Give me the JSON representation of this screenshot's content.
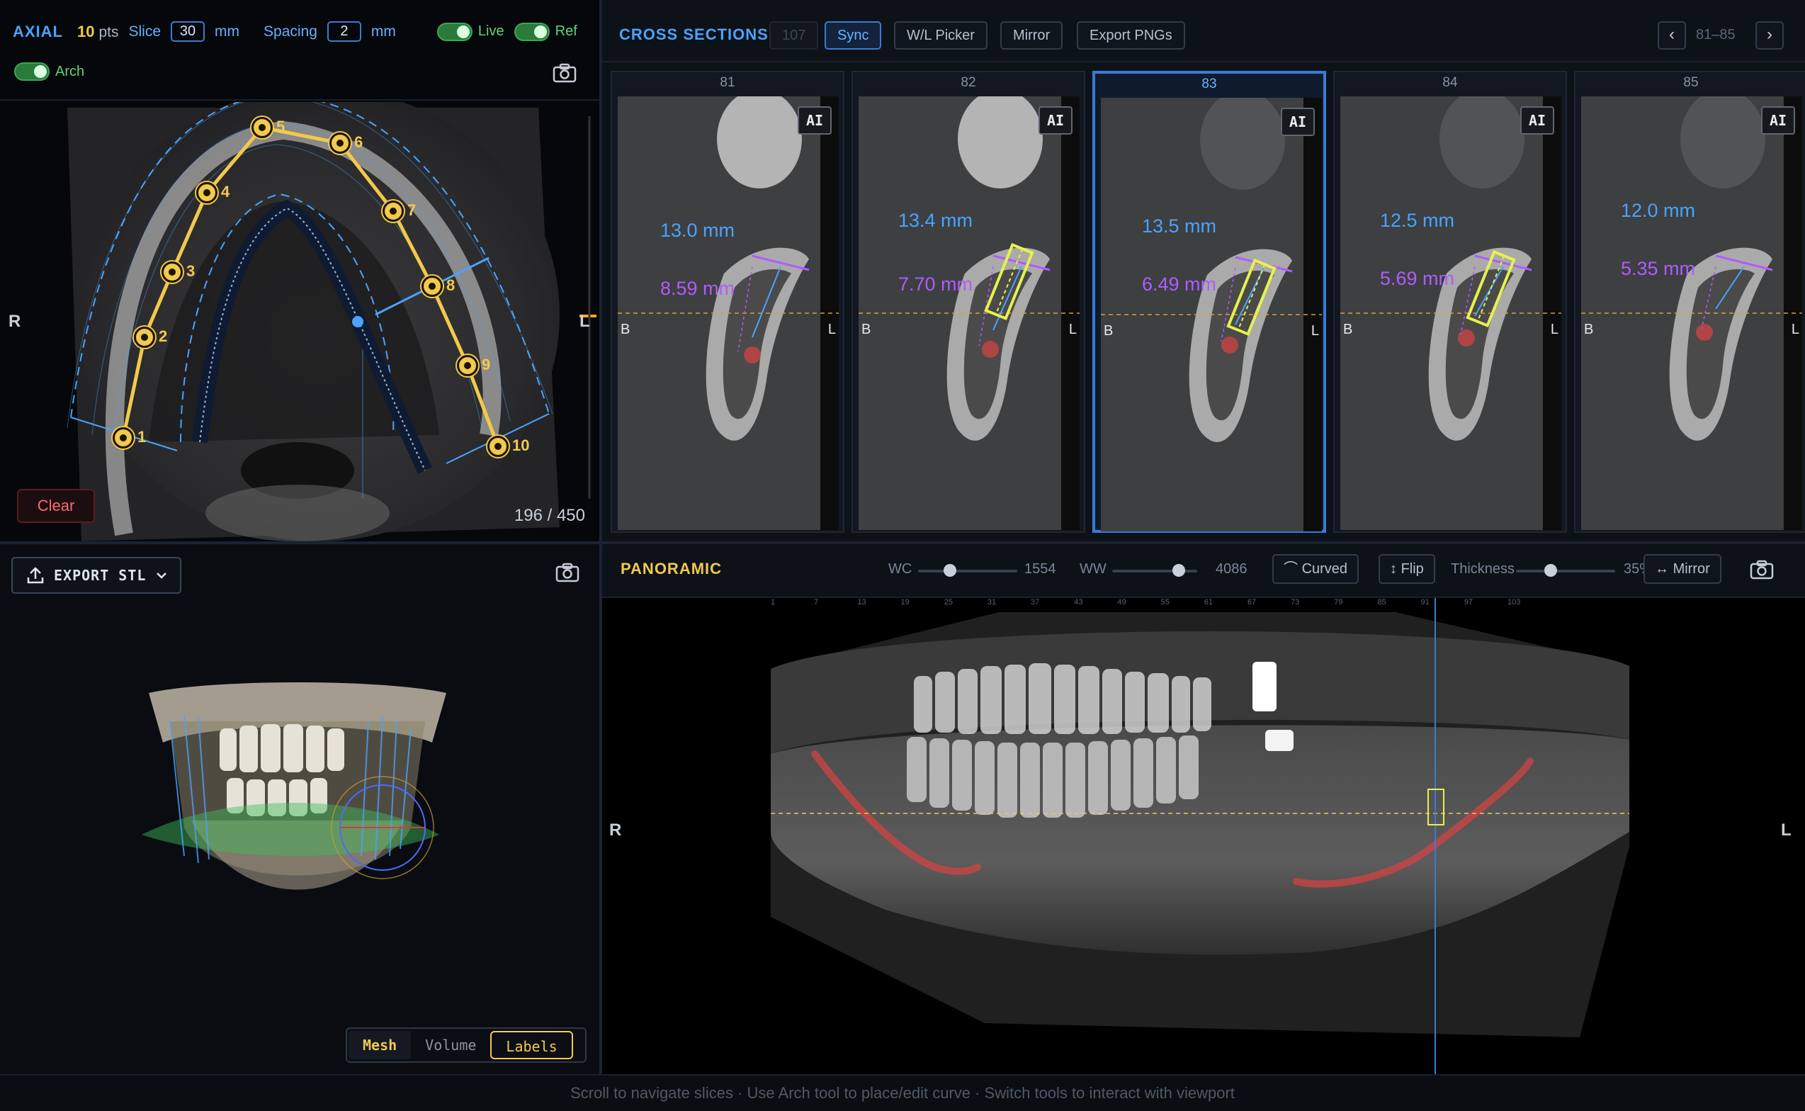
{
  "axial": {
    "title": "AXIAL",
    "points_value": "10",
    "points_unit": "pts",
    "slice_label": "Slice",
    "slice_value": "30",
    "slice_unit": "mm",
    "spacing_label": "Spacing",
    "spacing_value": "2",
    "spacing_unit": "mm",
    "toggles": [
      {
        "label": "Live",
        "on": true
      },
      {
        "label": "Ref",
        "on": true
      },
      {
        "label": "Arch",
        "on": true
      }
    ],
    "side_left": "R",
    "side_right": "L",
    "control_points": [
      "1",
      "2",
      "3",
      "4",
      "5",
      "6",
      "7",
      "8",
      "9",
      "10"
    ],
    "clear_label": "Clear",
    "slice_counter": "196 / 450",
    "icons": {
      "snapshot": "camera-icon"
    }
  },
  "model3d": {
    "export_label": "EXPORT STL",
    "modes": [
      "Mesh",
      "Volume",
      "Labels"
    ],
    "active_mode": "Mesh",
    "icons": {
      "export": "upload-icon",
      "dropdown": "chevron-down-icon",
      "snapshot": "camera-icon"
    }
  },
  "cross_sections": {
    "title": "CROSS SECTIONS",
    "count": "107",
    "buttons": {
      "sync": "Sync",
      "wl_picker": "W/L Picker",
      "mirror": "Mirror",
      "export_pngs": "Export PNGs"
    },
    "range": "81–85",
    "selected": "83",
    "ai_badge": "AI",
    "side_b": "B",
    "side_l": "L",
    "cards": [
      {
        "num": "81",
        "height_mm": "13.0 mm",
        "width_mm": "8.59 mm"
      },
      {
        "num": "82",
        "height_mm": "13.4 mm",
        "width_mm": "7.70 mm"
      },
      {
        "num": "83",
        "height_mm": "13.5 mm",
        "width_mm": "6.49 mm"
      },
      {
        "num": "84",
        "height_mm": "12.5 mm",
        "width_mm": "5.69 mm"
      },
      {
        "num": "85",
        "height_mm": "12.0 mm",
        "width_mm": "5.35 mm"
      }
    ]
  },
  "panoramic": {
    "title": "PANORAMIC",
    "wc_label": "WC",
    "wc_value": "1554",
    "wc_level": 0.32,
    "ww_label": "WW",
    "ww_value": "4086",
    "ww_level": 0.78,
    "curved_label": "Curved",
    "flip_label": "Flip",
    "thickness_label": "Thickness",
    "thickness_value": "35%",
    "thickness_level": 0.35,
    "mirror_label": "Mirror",
    "side_left": "R",
    "side_right": "L",
    "ruler_labels": [
      "1",
      "7",
      "13",
      "19",
      "25",
      "31",
      "37",
      "43",
      "49",
      "55",
      "61",
      "67",
      "73",
      "79",
      "85",
      "91",
      "97",
      "103"
    ],
    "marker_position": "83",
    "icons": {
      "curved": "curve-icon",
      "flip": "flip-vertical-icon",
      "mirror": "mirror-arrows-icon",
      "snapshot": "camera-icon"
    }
  },
  "status_bar": "Scroll to navigate slices · Use Arch tool to place/edit curve · Switch tools to interact with viewport",
  "colors": {
    "accent_blue": "#4aa3ff",
    "accent_yellow": "#f2c94c",
    "measure_purple": "#b05cff",
    "toggle_green": "#3aa653",
    "danger_red": "#ff6b6b"
  }
}
